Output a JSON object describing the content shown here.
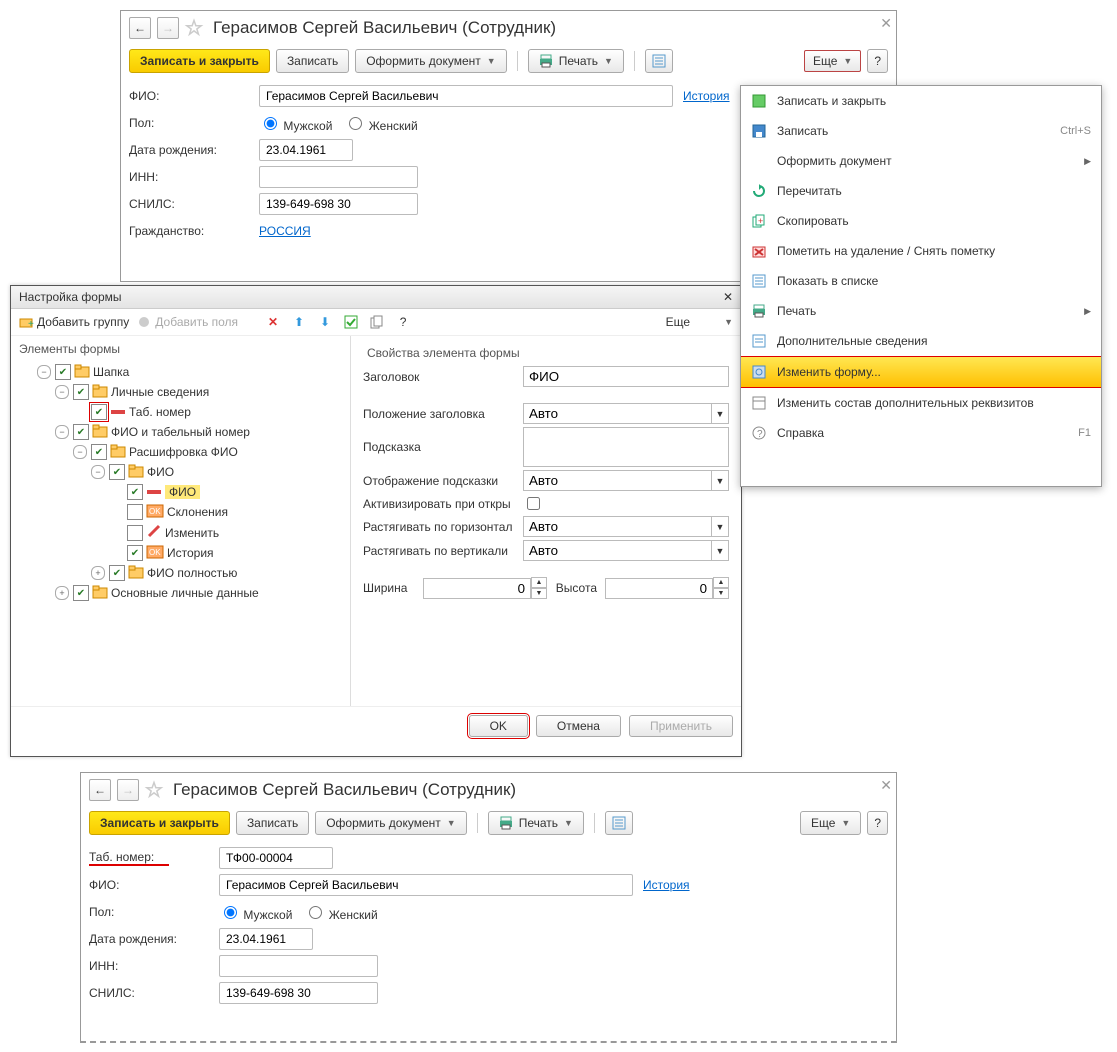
{
  "title_full": "Герасимов Сергей Васильевич (Сотрудник)",
  "toolbar": {
    "save_close": "Записать и закрыть",
    "save": "Записать",
    "create_doc": "Оформить документ",
    "print": "Печать",
    "more": "Еще",
    "help": "?"
  },
  "form1": {
    "fio_lbl": "ФИО:",
    "fio_val": "Герасимов Сергей Васильевич",
    "history": "История",
    "gender_lbl": "Пол:",
    "gender_m": "Мужской",
    "gender_f": "Женский",
    "dob_lbl": "Дата рождения:",
    "dob_val": "23.04.1961",
    "inn_lbl": "ИНН:",
    "inn_val": "",
    "snils_lbl": "СНИЛС:",
    "snils_val": "139-649-698 30",
    "citizenship_lbl": "Гражданство:",
    "citizenship_val": "РОССИЯ"
  },
  "form2": {
    "tab_no_lbl": "Таб. номер:",
    "tab_no_val": "ТФ00-00004"
  },
  "menu": {
    "items": [
      {
        "label": "Записать и закрыть",
        "icon": "save-close-icon"
      },
      {
        "label": "Записать",
        "icon": "save-icon",
        "extra": "Ctrl+S"
      },
      {
        "label": "Оформить документ",
        "icon": "",
        "sub": true
      },
      {
        "label": "Перечитать",
        "icon": "refresh-icon"
      },
      {
        "label": "Скопировать",
        "icon": "copy-icon"
      },
      {
        "label": "Пометить на удаление / Снять пометку",
        "icon": "delete-mark-icon"
      },
      {
        "label": "Показать в списке",
        "icon": "list-icon"
      },
      {
        "label": "Печать",
        "icon": "print-icon",
        "sub": true
      },
      {
        "label": "Дополнительные сведения",
        "icon": "info-icon"
      },
      {
        "label": "Изменить форму...",
        "icon": "form-edit-icon",
        "highlight": true
      },
      {
        "label": "Изменить состав дополнительных реквизитов",
        "icon": "props-icon"
      },
      {
        "label": "Справка",
        "icon": "help-icon",
        "extra": "F1"
      }
    ]
  },
  "dialog": {
    "title": "Настройка формы",
    "add_group": "Добавить группу",
    "add_fields": "Добавить поля",
    "more": "Еще",
    "elems_hdr": "Элементы формы",
    "props_hdr": "Свойства элемента формы",
    "tree": [
      {
        "lvl": 1,
        "chk": true,
        "exp": "-",
        "t": "folder",
        "label": "Шапка"
      },
      {
        "lvl": 2,
        "chk": true,
        "exp": "-",
        "t": "folder",
        "label": "Личные сведения"
      },
      {
        "lvl": 3,
        "chk": true,
        "hl": "box",
        "t": "minus",
        "label": "Таб. номер"
      },
      {
        "lvl": 2,
        "chk": true,
        "exp": "-",
        "t": "folder",
        "label": "ФИО и табельный номер"
      },
      {
        "lvl": 3,
        "chk": true,
        "exp": "-",
        "t": "folder",
        "label": "Расшифровка ФИО"
      },
      {
        "lvl": 4,
        "chk": true,
        "exp": "-",
        "t": "folder",
        "label": "ФИО"
      },
      {
        "lvl": 5,
        "chk": true,
        "t": "minus",
        "sel": true,
        "label": "ФИО"
      },
      {
        "lvl": 5,
        "chk": false,
        "t": "ok",
        "label": "Склонения"
      },
      {
        "lvl": 5,
        "chk": false,
        "t": "edit",
        "label": "Изменить"
      },
      {
        "lvl": 5,
        "chk": true,
        "t": "ok",
        "label": "История"
      },
      {
        "lvl": 4,
        "chk": true,
        "exp": "+",
        "t": "folder",
        "label": "ФИО полностью"
      },
      {
        "lvl": 2,
        "chk": true,
        "exp": "+",
        "t": "folder",
        "label": "Основные личные данные"
      }
    ],
    "props": {
      "title_lbl": "Заголовок",
      "title_val": "ФИО",
      "pos_lbl": "Положение заголовка",
      "pos_val": "Авто",
      "hint_lbl": "Подсказка",
      "hint_val": "",
      "hint_disp_lbl": "Отображение подсказки",
      "hint_disp_val": "Авто",
      "activate_lbl": "Активизировать при откры",
      "stretch_h_lbl": "Растягивать по горизонтал",
      "stretch_h_val": "Авто",
      "stretch_v_lbl": "Растягивать по вертикали",
      "stretch_v_val": "Авто",
      "width_lbl": "Ширина",
      "width_val": "0",
      "height_lbl": "Высота",
      "height_val": "0"
    },
    "ok": "OK",
    "cancel": "Отмена",
    "apply": "Применить"
  }
}
